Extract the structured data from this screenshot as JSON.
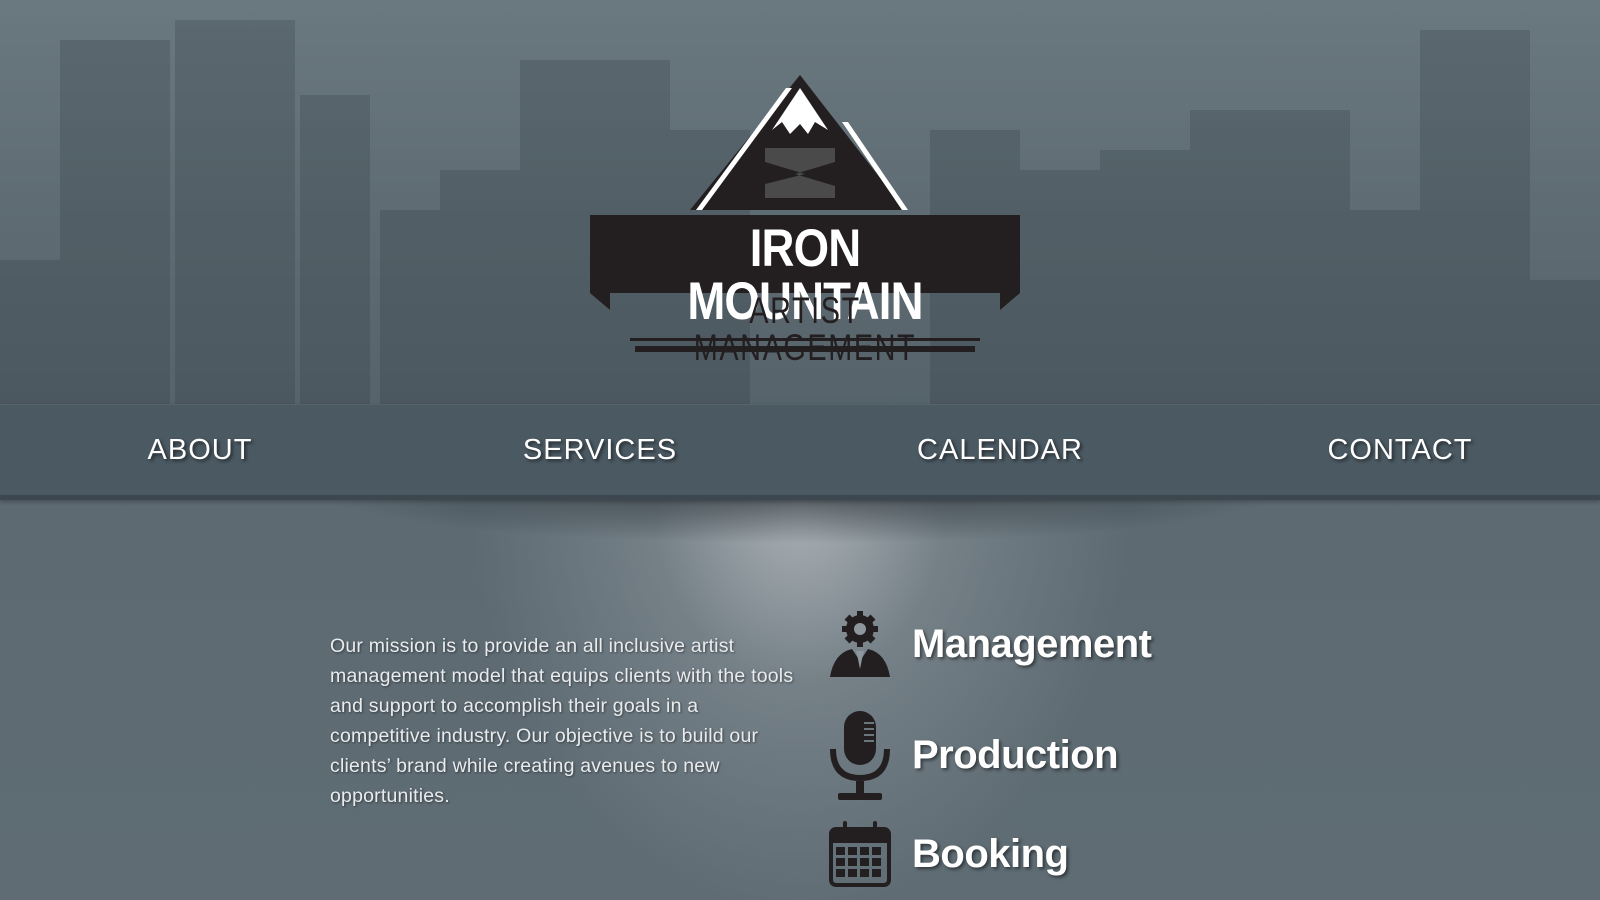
{
  "logo": {
    "title": "IRON MOUNTAIN",
    "subtitle": "ARTIST MANAGEMENT"
  },
  "nav": {
    "items": [
      {
        "label": "ABOUT"
      },
      {
        "label": "SERVICES"
      },
      {
        "label": "CALENDAR"
      },
      {
        "label": "CONTACT"
      }
    ]
  },
  "mission": {
    "text": "Our mission is to provide an all inclusive artist management model that equips clients with the tools and support to accomplish their goals in a competitive industry. Our objective is to build our clients’ brand while creating avenues to new opportunities."
  },
  "services": [
    {
      "label": "Management",
      "icon": "manager-gear-icon"
    },
    {
      "label": "Production",
      "icon": "microphone-icon"
    },
    {
      "label": "Booking",
      "icon": "calendar-icon"
    }
  ],
  "colors": {
    "nav_background": "#4b5962",
    "page_background": "#5f6d76",
    "logo_dark": "#231f20",
    "text_light": "#ffffff"
  }
}
